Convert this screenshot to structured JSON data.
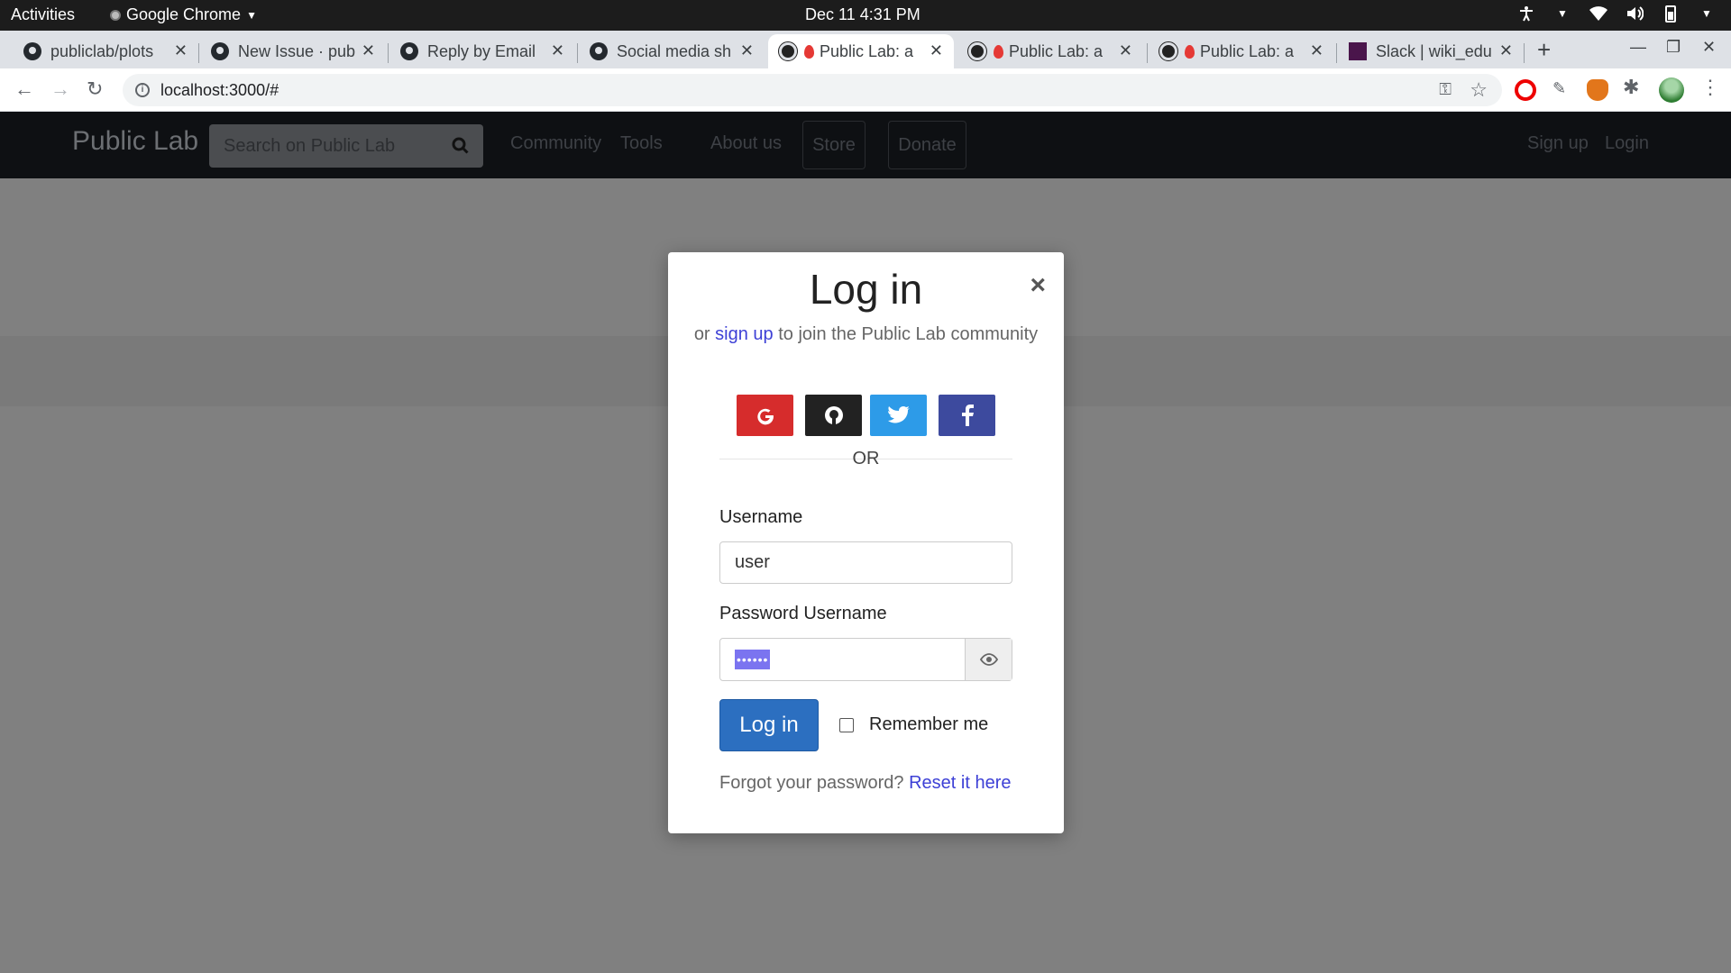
{
  "system_bar": {
    "activities": "Activities",
    "app_name": "Google Chrome",
    "clock": "Dec 11  4:31 PM"
  },
  "tabs": [
    {
      "title": "publiclab/plots"
    },
    {
      "title": "New Issue · pub"
    },
    {
      "title": "Reply by Email"
    },
    {
      "title": "Social media sh"
    },
    {
      "title": "Public Lab: a"
    },
    {
      "title": "Public Lab: a"
    },
    {
      "title": "Public Lab: a"
    },
    {
      "title": "Slack | wiki_edu"
    }
  ],
  "browser": {
    "url": "localhost:3000/#"
  },
  "site": {
    "brand": "Public Lab",
    "search_placeholder": "Search on Public Lab",
    "nav": {
      "community": "Community",
      "tools": "Tools",
      "about": "About us",
      "store": "Store",
      "donate": "Donate",
      "signup": "Sign up",
      "login": "Login"
    }
  },
  "modal": {
    "title": "Log in",
    "sub_prefix": "or",
    "sub_link": "sign up",
    "sub_suffix": "to join the Public Lab community",
    "or_text": "OR",
    "username_label": "Username",
    "username_value": "user",
    "password_label": "Password Username",
    "password_value": "••••••",
    "login_button": "Log in",
    "remember_label": "Remember me",
    "forgot_text": "Forgot your password?",
    "reset_link": "Reset it here"
  },
  "colors": {
    "google": "#d62c2c",
    "github": "#222222",
    "twitter": "#2d9be8",
    "facebook": "#3d4a9e",
    "primary": "#2c6fc0",
    "link": "#3d40d6"
  }
}
